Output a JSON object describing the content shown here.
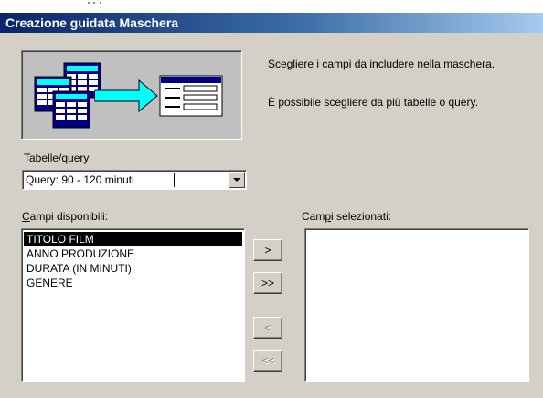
{
  "window": {
    "title": "Creazione guidata Maschera"
  },
  "description": {
    "line1": "Scegliere i campi da includere nella maschera.",
    "line2": "È possibile scegliere da più tabelle o query."
  },
  "table_query": {
    "label": "Tabelle/query",
    "value": "Query: 90 - 120 minuti"
  },
  "available": {
    "label_pre": "",
    "label_u": "C",
    "label_post": "ampi disponibili:",
    "items": [
      "TITOLO FILM",
      "ANNO PRODUZIONE",
      "DURATA (IN MINUTI)",
      "GENERE"
    ],
    "selected_index": 0
  },
  "selected": {
    "label_pre": "Cam",
    "label_u": "p",
    "label_post": "i selezionati:",
    "items": []
  },
  "buttons": {
    "add_one": ">",
    "add_all": ">>",
    "remove_one": "<",
    "remove_all": "<<"
  }
}
